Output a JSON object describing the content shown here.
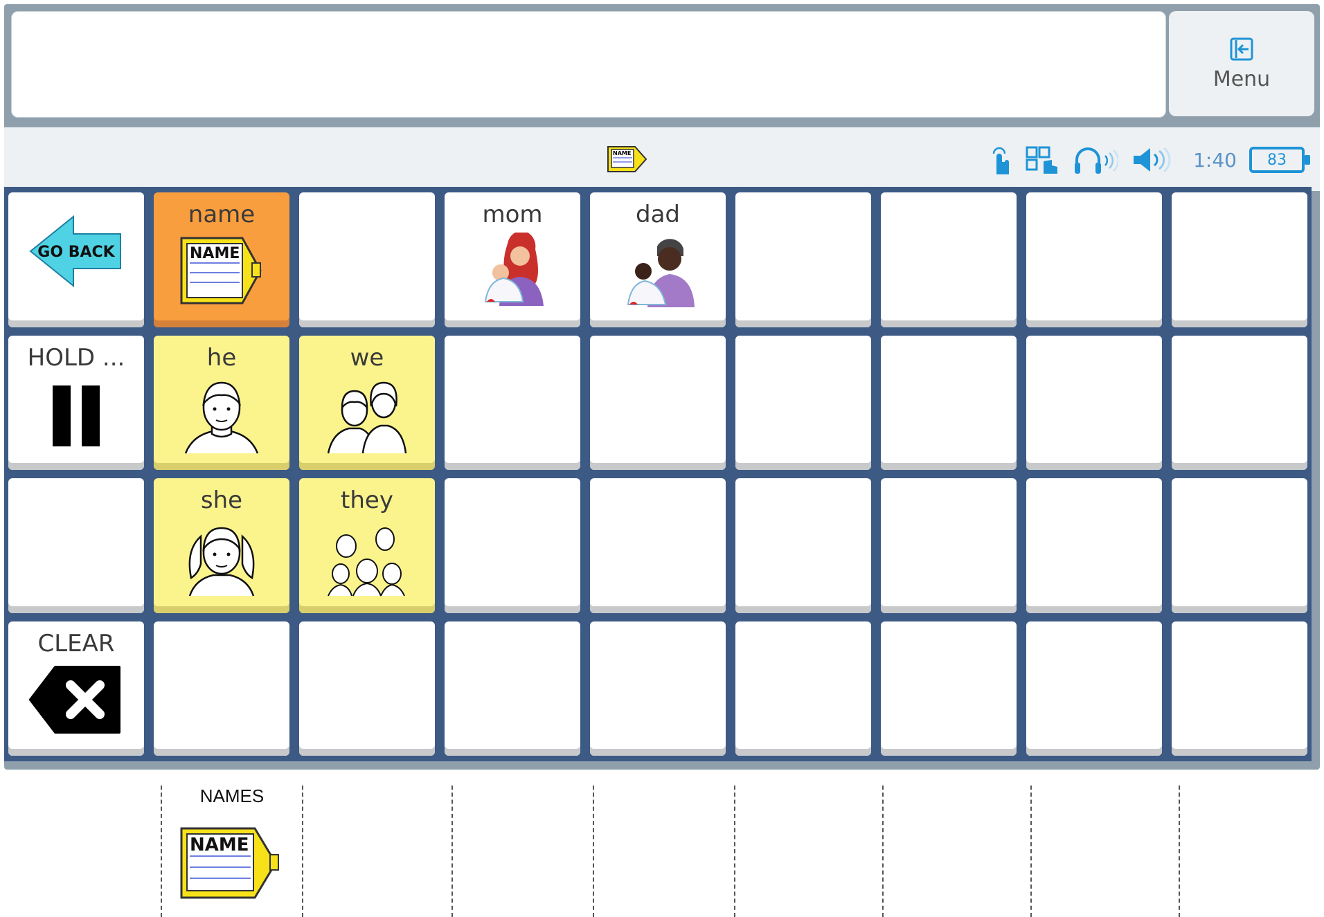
{
  "message_bar": {
    "text": ""
  },
  "menu": {
    "label": "Menu",
    "icon": "exit-icon"
  },
  "status": {
    "time": "1:40",
    "battery": "83",
    "page_icon": "name-tag-icon",
    "icons": [
      "touch-icon",
      "scan-icon",
      "headphones-icon",
      "speaker-icon"
    ]
  },
  "cells": {
    "go_back": "GO BACK",
    "name": "name",
    "mom": "mom",
    "dad": "dad",
    "hold": "HOLD ...",
    "he": "he",
    "we": "we",
    "she": "she",
    "they": "they",
    "clear": "CLEAR"
  },
  "name_tag_text": "NAME",
  "strip": {
    "names_label": "NAMES"
  },
  "colors": {
    "grid": "#3d5a85",
    "core_yellow": "#fbf48d",
    "folder_orange": "#f99e3e",
    "accent_blue": "#1e94d6"
  }
}
